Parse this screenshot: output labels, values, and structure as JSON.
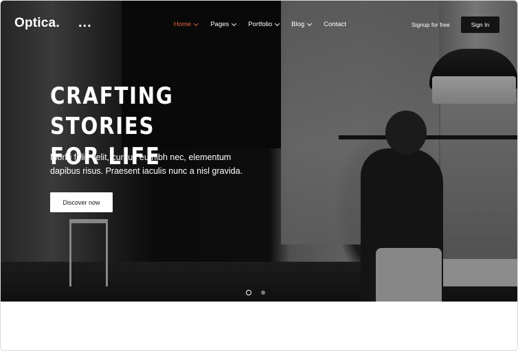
{
  "brand": {
    "logo": "Optica.",
    "more_dots": "..."
  },
  "nav": {
    "items": [
      {
        "label": "Home",
        "active": true,
        "has_dropdown": true
      },
      {
        "label": "Pages",
        "active": false,
        "has_dropdown": true
      },
      {
        "label": "Portfolio",
        "active": false,
        "has_dropdown": true
      },
      {
        "label": "Blog",
        "active": false,
        "has_dropdown": true
      },
      {
        "label": "Contact",
        "active": false,
        "has_dropdown": false
      }
    ],
    "signup_label": "Signup for free",
    "signin_label": "Sign In"
  },
  "hero": {
    "headline_line1": "CRAFTING STORIES",
    "headline_line2": "FOR LIFE",
    "subtext": "Morbi felis velit, cursus eu nibh nec, elementum dapibus risus. Praesent iaculis nunc a nisl gravida.",
    "cta_label": "Discover now",
    "slides_total": 2,
    "active_slide": 1
  },
  "colors": {
    "accent": "#e0653b",
    "button_dark": "#141414"
  }
}
